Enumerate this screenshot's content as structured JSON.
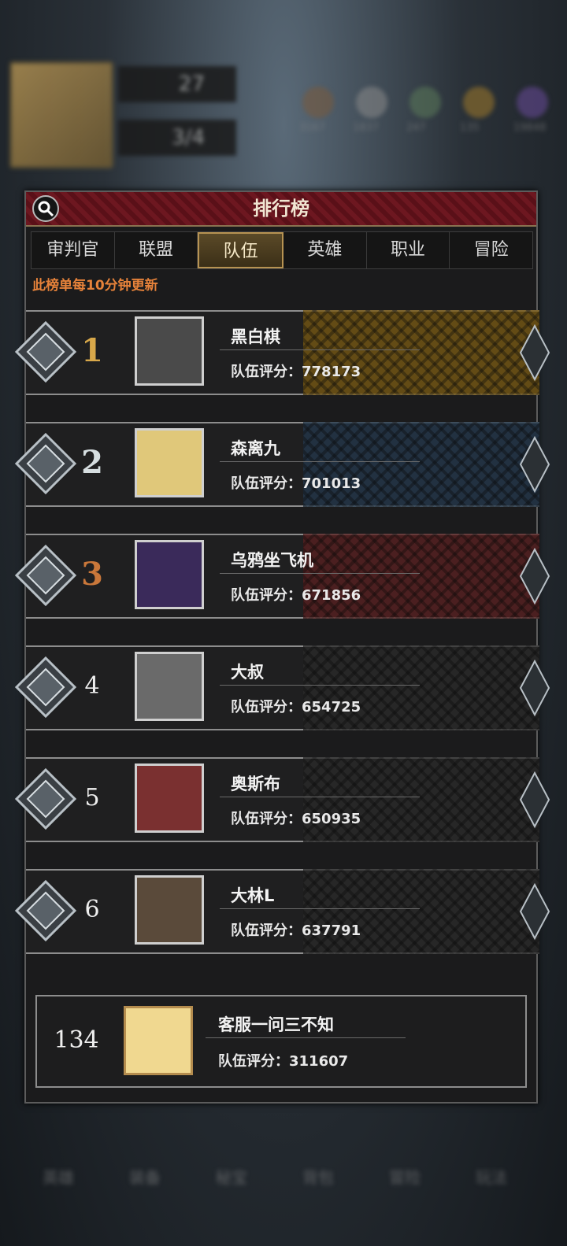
{
  "background": {
    "level": "27",
    "energy": "3/4",
    "resources": [
      {
        "label": "3167",
        "color": "#7a5a3a"
      },
      {
        "label": "1837",
        "color": "#8a8a8a"
      },
      {
        "label": "247",
        "color": "#5b7a5a"
      },
      {
        "label": "135",
        "color": "#a07a2a"
      },
      {
        "label": "19848",
        "color": "#6a4a9a"
      }
    ],
    "nav": [
      "英雄",
      "装备",
      "秘宝",
      "背包",
      "冒险",
      "玩法"
    ]
  },
  "panel": {
    "title": "排行榜",
    "tabs": [
      "审判官",
      "联盟",
      "队伍",
      "英雄",
      "职业",
      "冒险"
    ],
    "active_tab": "队伍",
    "note": "此榜单每10分钟更新"
  },
  "rows": [
    {
      "rank": "1",
      "name": "黑白棋",
      "score": "队伍评分：778173",
      "glow": "#7a5a12",
      "avatar_color": "#4a4a4a"
    },
    {
      "rank": "2",
      "name": "森离九",
      "score": "队伍评分：701013",
      "glow": "#23384c",
      "avatar_color": "#e0c87a"
    },
    {
      "rank": "3",
      "name": "乌鸦坐飞机",
      "score": "队伍评分：671856",
      "glow": "#5a2020",
      "avatar_color": "#3a2a5a"
    },
    {
      "rank": "4",
      "name": "大叔",
      "score": "队伍评分：654725",
      "glow": "#2a2a2a",
      "avatar_color": "#6a6a6a"
    },
    {
      "rank": "5",
      "name": "奥斯布",
      "score": "队伍评分：650935",
      "glow": "#2a2a2a",
      "avatar_color": "#7a3030"
    },
    {
      "rank": "6",
      "name": "大林L",
      "score": "队伍评分：637791",
      "glow": "#2a2a2a",
      "avatar_color": "#5a4a3a"
    }
  ],
  "self": {
    "rank": "134",
    "name": "客服一问三不知",
    "score": "队伍评分：311607",
    "avatar_color": "#f0d890"
  }
}
